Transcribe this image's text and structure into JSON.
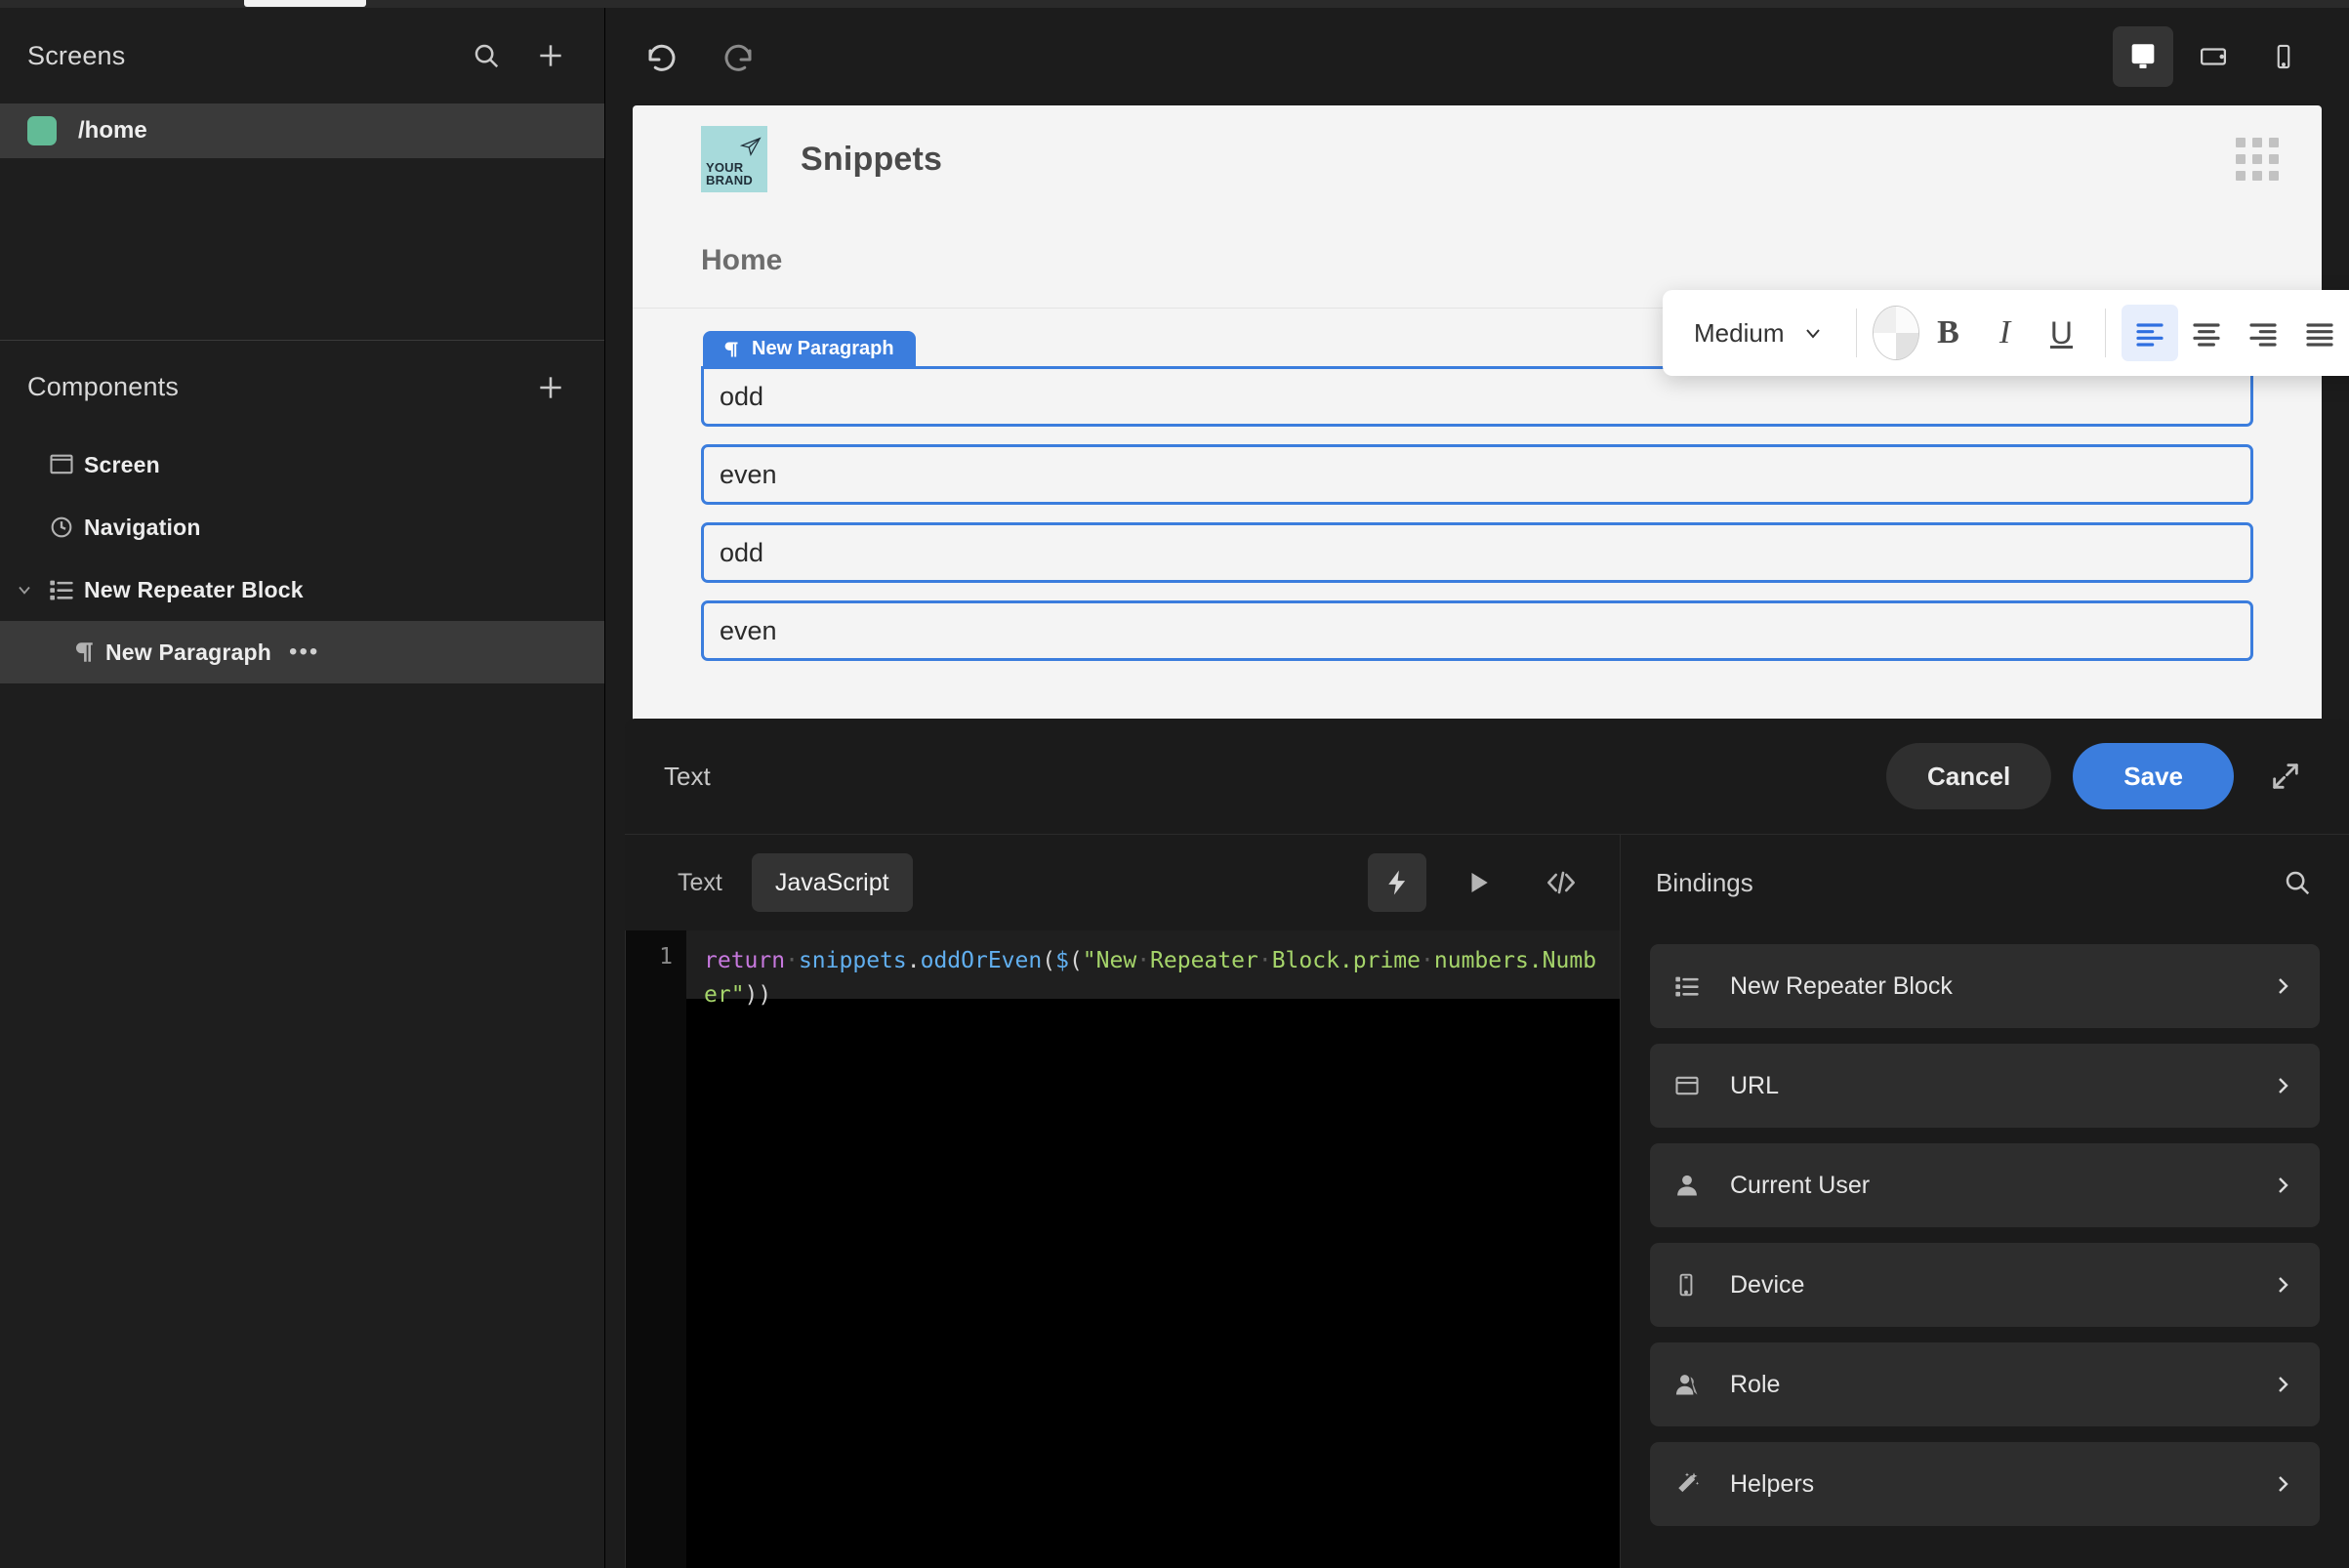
{
  "sidebar": {
    "screens": {
      "title": "Screens",
      "search_icon": "search-icon",
      "add_icon": "plus-icon",
      "items": [
        {
          "label": "/home",
          "color": "#62bb96"
        }
      ]
    },
    "components": {
      "title": "Components",
      "add_icon": "plus-icon",
      "items": [
        {
          "label": "Screen",
          "icon": "screen-icon",
          "indent": 1,
          "selected": false,
          "caret": false
        },
        {
          "label": "Navigation",
          "icon": "navigation-icon",
          "indent": 1,
          "selected": false,
          "caret": false
        },
        {
          "label": "New Repeater Block",
          "icon": "repeater-icon",
          "indent": 1,
          "selected": false,
          "caret": true
        },
        {
          "label": "New Paragraph",
          "icon": "paragraph-icon",
          "indent": 2,
          "selected": true,
          "caret": false,
          "more": "•••"
        }
      ]
    }
  },
  "toolbar": {
    "undo_icon": "undo-icon",
    "redo_icon": "redo-icon",
    "devices": [
      {
        "name": "desktop-icon",
        "active": true
      },
      {
        "name": "tablet-icon",
        "active": false
      },
      {
        "name": "mobile-icon",
        "active": false
      }
    ]
  },
  "canvas": {
    "brand": {
      "line1": "YOUR",
      "line2": "BRAND",
      "color": "#a7dadb"
    },
    "app_title": "Snippets",
    "grid_icon": "grid-dots-icon",
    "screen_title": "Home",
    "selected_badge": {
      "icon": "paragraph-icon",
      "label": "New Paragraph",
      "color": "#3b7ddd"
    },
    "fields": [
      {
        "value": "odd"
      },
      {
        "value": "even"
      },
      {
        "value": "odd"
      },
      {
        "value": "even"
      }
    ]
  },
  "format_toolbar": {
    "size_label": "Medium",
    "chevron_icon": "chevron-down-icon",
    "color_icon": "color-wheel-icon",
    "bold_label": "B",
    "italic_label": "I",
    "underline_label": "U",
    "align": [
      {
        "name": "align-left-icon",
        "active": true
      },
      {
        "name": "align-center-icon",
        "active": false
      },
      {
        "name": "align-right-icon",
        "active": false
      },
      {
        "name": "align-justify-icon",
        "active": false
      }
    ],
    "duplicate_icon": "duplicate-icon",
    "delete_icon": "trash-icon"
  },
  "editor": {
    "title": "Text",
    "cancel_label": "Cancel",
    "save_label": "Save",
    "expand_icon": "expand-icon",
    "tabs": [
      {
        "label": "Text",
        "active": false
      },
      {
        "label": "JavaScript",
        "active": true
      }
    ],
    "actions": [
      {
        "name": "lightning-icon",
        "active": true
      },
      {
        "name": "play-icon",
        "active": false
      },
      {
        "name": "code-icon",
        "active": false
      }
    ],
    "code": {
      "line_number": "1",
      "tokens": [
        {
          "t": "return",
          "c": "k-return"
        },
        {
          "t": "·",
          "c": "dot"
        },
        {
          "t": "snippets",
          "c": "k-id"
        },
        {
          "t": ".",
          "c": "k-plain"
        },
        {
          "t": "oddOrEven",
          "c": "k-id"
        },
        {
          "t": "(",
          "c": "k-plain"
        },
        {
          "t": "$",
          "c": "k-id"
        },
        {
          "t": "(",
          "c": "k-plain"
        },
        {
          "t": "\"New·Repeater·Block.prime·numbers.Number\"",
          "c": "k-str"
        },
        {
          "t": "))",
          "c": "k-plain"
        }
      ],
      "plain": "return snippets.oddOrEven($(\"New Repeater Block.prime numbers.Number\"))"
    },
    "bindings": {
      "title": "Bindings",
      "search_icon": "search-icon",
      "items": [
        {
          "label": "New Repeater Block",
          "icon": "repeater-icon"
        },
        {
          "label": "URL",
          "icon": "url-icon"
        },
        {
          "label": "Current User",
          "icon": "user-icon"
        },
        {
          "label": "Device",
          "icon": "mobile-icon"
        },
        {
          "label": "Role",
          "icon": "role-icon"
        },
        {
          "label": "Helpers",
          "icon": "wand-icon"
        }
      ]
    }
  }
}
